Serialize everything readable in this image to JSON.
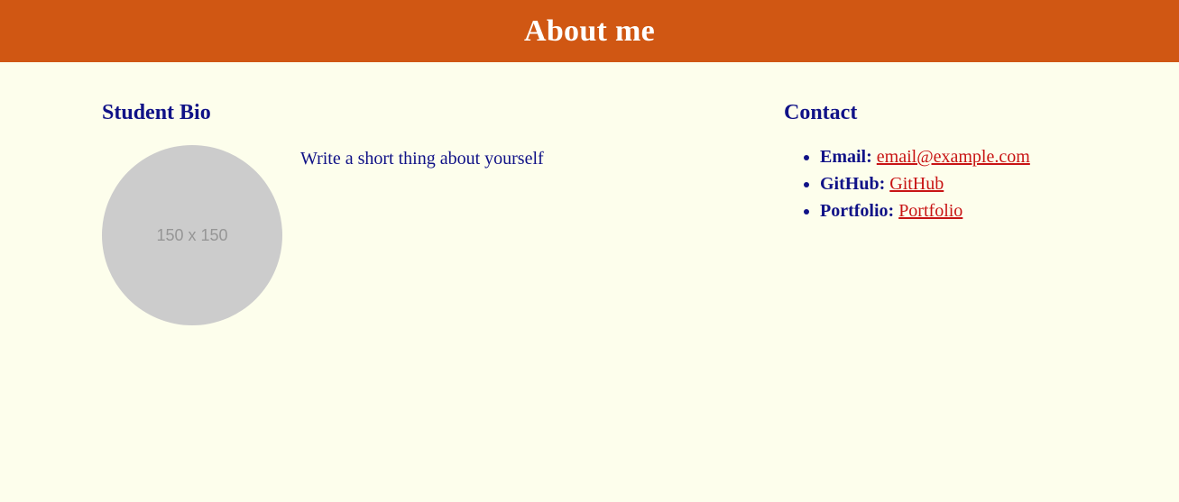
{
  "header": {
    "title": "About me",
    "bg_color": "#d05713"
  },
  "bio": {
    "heading": "Student Bio",
    "avatar_placeholder": "150 x 150",
    "text": "Write a short thing about yourself"
  },
  "contact": {
    "heading": "Contact",
    "items": [
      {
        "label": "Email:",
        "link_text": "email@example.com"
      },
      {
        "label": "GitHub:",
        "link_text": "GitHub"
      },
      {
        "label": "Portfolio:",
        "link_text": "Portfolio"
      }
    ]
  },
  "colors": {
    "heading": "#101287",
    "link": "#c81414",
    "page_bg": "#fdfeec"
  }
}
